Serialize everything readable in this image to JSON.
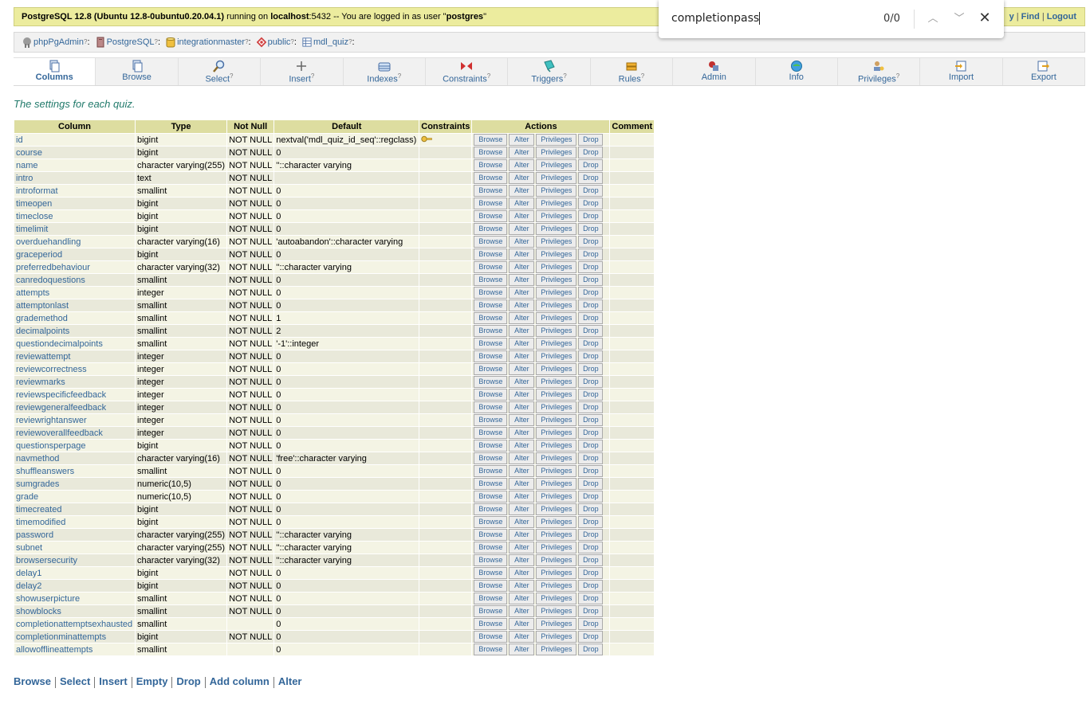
{
  "topbar": {
    "server_name": "PostgreSQL 12.8 (Ubuntu 12.8-0ubuntu0.20.04.1)",
    "running_on": " running on ",
    "host": "localhost",
    "port": ":5432",
    "logged_in_text": " -- You are logged in as user \"",
    "user": "postgres",
    "close_quote": "\"",
    "links": [
      "y",
      "Find",
      "Logout"
    ]
  },
  "trail": {
    "items": [
      {
        "label": "phpPgAdmin",
        "icon": "phppgadmin-icon"
      },
      {
        "label": "PostgreSQL",
        "icon": "server-icon"
      },
      {
        "label": "integrationmaster",
        "icon": "database-icon"
      },
      {
        "label": "public",
        "icon": "schema-icon"
      },
      {
        "label": "mdl_quiz",
        "icon": "table-icon"
      }
    ],
    "help": "?",
    "sep": ":"
  },
  "tabs": [
    {
      "label": "Columns",
      "icon": "columns-icon",
      "help": ""
    },
    {
      "label": "Browse",
      "icon": "browse-icon",
      "help": ""
    },
    {
      "label": "Select",
      "icon": "select-icon",
      "help": "?"
    },
    {
      "label": "Insert",
      "icon": "insert-icon",
      "help": "?"
    },
    {
      "label": "Indexes",
      "icon": "indexes-icon",
      "help": "?"
    },
    {
      "label": "Constraints",
      "icon": "constraints-icon",
      "help": "?"
    },
    {
      "label": "Triggers",
      "icon": "triggers-icon",
      "help": "?"
    },
    {
      "label": "Rules",
      "icon": "rules-icon",
      "help": "?"
    },
    {
      "label": "Admin",
      "icon": "admin-icon",
      "help": ""
    },
    {
      "label": "Info",
      "icon": "info-icon",
      "help": ""
    },
    {
      "label": "Privileges",
      "icon": "privileges-icon",
      "help": "?"
    },
    {
      "label": "Import",
      "icon": "import-icon",
      "help": ""
    },
    {
      "label": "Export",
      "icon": "export-icon",
      "help": ""
    }
  ],
  "comment": "The settings for each quiz.",
  "table": {
    "headers": [
      "Column",
      "Type",
      "Not Null",
      "Default",
      "Constraints",
      "Actions",
      "Comment"
    ],
    "actions": [
      "Browse",
      "Alter",
      "Privileges",
      "Drop"
    ],
    "rows": [
      {
        "name": "id",
        "type": "bigint",
        "notnull": "NOT NULL",
        "default": "nextval('mdl_quiz_id_seq'::regclass)",
        "pk": true
      },
      {
        "name": "course",
        "type": "bigint",
        "notnull": "NOT NULL",
        "default": "0"
      },
      {
        "name": "name",
        "type": "character varying(255)",
        "notnull": "NOT NULL",
        "default": "''::character varying"
      },
      {
        "name": "intro",
        "type": "text",
        "notnull": "NOT NULL",
        "default": ""
      },
      {
        "name": "introformat",
        "type": "smallint",
        "notnull": "NOT NULL",
        "default": "0"
      },
      {
        "name": "timeopen",
        "type": "bigint",
        "notnull": "NOT NULL",
        "default": "0"
      },
      {
        "name": "timeclose",
        "type": "bigint",
        "notnull": "NOT NULL",
        "default": "0"
      },
      {
        "name": "timelimit",
        "type": "bigint",
        "notnull": "NOT NULL",
        "default": "0"
      },
      {
        "name": "overduehandling",
        "type": "character varying(16)",
        "notnull": "NOT NULL",
        "default": "'autoabandon'::character varying"
      },
      {
        "name": "graceperiod",
        "type": "bigint",
        "notnull": "NOT NULL",
        "default": "0"
      },
      {
        "name": "preferredbehaviour",
        "type": "character varying(32)",
        "notnull": "NOT NULL",
        "default": "''::character varying"
      },
      {
        "name": "canredoquestions",
        "type": "smallint",
        "notnull": "NOT NULL",
        "default": "0"
      },
      {
        "name": "attempts",
        "type": "integer",
        "notnull": "NOT NULL",
        "default": "0"
      },
      {
        "name": "attemptonlast",
        "type": "smallint",
        "notnull": "NOT NULL",
        "default": "0"
      },
      {
        "name": "grademethod",
        "type": "smallint",
        "notnull": "NOT NULL",
        "default": "1"
      },
      {
        "name": "decimalpoints",
        "type": "smallint",
        "notnull": "NOT NULL",
        "default": "2"
      },
      {
        "name": "questiondecimalpoints",
        "type": "smallint",
        "notnull": "NOT NULL",
        "default": "'-1'::integer"
      },
      {
        "name": "reviewattempt",
        "type": "integer",
        "notnull": "NOT NULL",
        "default": "0"
      },
      {
        "name": "reviewcorrectness",
        "type": "integer",
        "notnull": "NOT NULL",
        "default": "0"
      },
      {
        "name": "reviewmarks",
        "type": "integer",
        "notnull": "NOT NULL",
        "default": "0"
      },
      {
        "name": "reviewspecificfeedback",
        "type": "integer",
        "notnull": "NOT NULL",
        "default": "0"
      },
      {
        "name": "reviewgeneralfeedback",
        "type": "integer",
        "notnull": "NOT NULL",
        "default": "0"
      },
      {
        "name": "reviewrightanswer",
        "type": "integer",
        "notnull": "NOT NULL",
        "default": "0"
      },
      {
        "name": "reviewoverallfeedback",
        "type": "integer",
        "notnull": "NOT NULL",
        "default": "0"
      },
      {
        "name": "questionsperpage",
        "type": "bigint",
        "notnull": "NOT NULL",
        "default": "0"
      },
      {
        "name": "navmethod",
        "type": "character varying(16)",
        "notnull": "NOT NULL",
        "default": "'free'::character varying"
      },
      {
        "name": "shuffleanswers",
        "type": "smallint",
        "notnull": "NOT NULL",
        "default": "0"
      },
      {
        "name": "sumgrades",
        "type": "numeric(10,5)",
        "notnull": "NOT NULL",
        "default": "0"
      },
      {
        "name": "grade",
        "type": "numeric(10,5)",
        "notnull": "NOT NULL",
        "default": "0"
      },
      {
        "name": "timecreated",
        "type": "bigint",
        "notnull": "NOT NULL",
        "default": "0"
      },
      {
        "name": "timemodified",
        "type": "bigint",
        "notnull": "NOT NULL",
        "default": "0"
      },
      {
        "name": "password",
        "type": "character varying(255)",
        "notnull": "NOT NULL",
        "default": "''::character varying"
      },
      {
        "name": "subnet",
        "type": "character varying(255)",
        "notnull": "NOT NULL",
        "default": "''::character varying"
      },
      {
        "name": "browsersecurity",
        "type": "character varying(32)",
        "notnull": "NOT NULL",
        "default": "''::character varying"
      },
      {
        "name": "delay1",
        "type": "bigint",
        "notnull": "NOT NULL",
        "default": "0"
      },
      {
        "name": "delay2",
        "type": "bigint",
        "notnull": "NOT NULL",
        "default": "0"
      },
      {
        "name": "showuserpicture",
        "type": "smallint",
        "notnull": "NOT NULL",
        "default": "0"
      },
      {
        "name": "showblocks",
        "type": "smallint",
        "notnull": "NOT NULL",
        "default": "0"
      },
      {
        "name": "completionattemptsexhausted",
        "type": "smallint",
        "notnull": "",
        "default": "0"
      },
      {
        "name": "completionminattempts",
        "type": "bigint",
        "notnull": "NOT NULL",
        "default": "0"
      },
      {
        "name": "allowofflineattempts",
        "type": "smallint",
        "notnull": "",
        "default": "0"
      }
    ]
  },
  "bottom_links": [
    "Browse",
    "Select",
    "Insert",
    "Empty",
    "Drop",
    "Add column",
    "Alter"
  ],
  "findbar": {
    "query": "completionpass",
    "count": "0/0",
    "prev_icon": "chevron-up-icon",
    "next_icon": "chevron-down-icon",
    "close_icon": "close-icon"
  },
  "colors": {
    "link": "#336699",
    "topbar_bg": "#ecec9e",
    "header_bg": "#dddda0",
    "row_light": "#f4f4e4",
    "row_dark": "#e9e9da",
    "comment": "#217a6b"
  }
}
